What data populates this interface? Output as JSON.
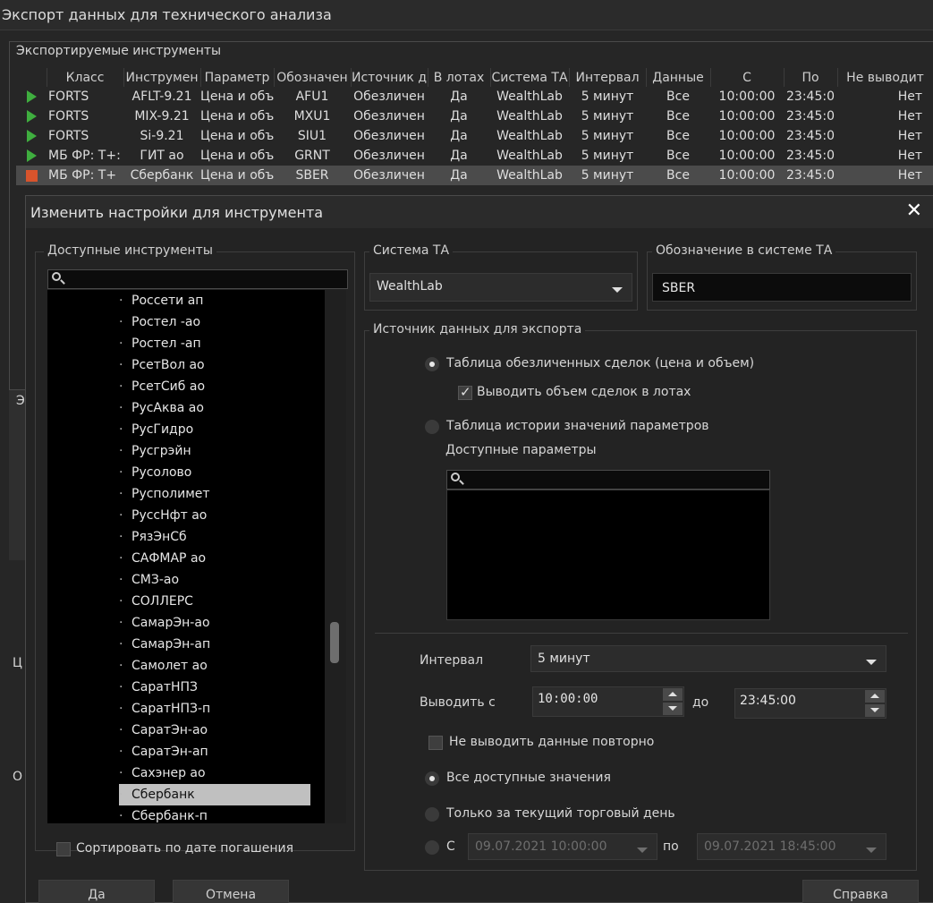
{
  "main_window": {
    "title": "Экспорт данных для технического анализа",
    "group_title": "Экспортируемые инструменты",
    "columns": [
      "",
      "Класс",
      "Инструмен",
      "Параметр",
      "Обозначен",
      "Источник д",
      "В лотах",
      "Система ТА",
      "Интервал",
      "Данные",
      "С",
      "По",
      "Не выводит"
    ],
    "rows": [
      {
        "status": "play",
        "class": "FORTS",
        "instrument": "AFLT-9.21",
        "param": "Цена и объ",
        "symbol": "AFU1",
        "source": "Обезличен",
        "lots": "Да",
        "ta": "WealthLab",
        "interval": "5 минут",
        "data": "Все",
        "from": "10:00:00",
        "to": "23:45:0",
        "no_repeat": "Нет"
      },
      {
        "status": "play",
        "class": "FORTS",
        "instrument": "MIX-9.21",
        "param": "Цена и объ",
        "symbol": "MXU1",
        "source": "Обезличен",
        "lots": "Да",
        "ta": "WealthLab",
        "interval": "5 минут",
        "data": "Все",
        "from": "10:00:00",
        "to": "23:45:0",
        "no_repeat": "Нет"
      },
      {
        "status": "play",
        "class": "FORTS",
        "instrument": "Si-9.21",
        "param": "Цена и объ",
        "symbol": "SIU1",
        "source": "Обезличен",
        "lots": "Да",
        "ta": "WealthLab",
        "interval": "5 минут",
        "data": "Все",
        "from": "10:00:00",
        "to": "23:45:0",
        "no_repeat": "Нет"
      },
      {
        "status": "play",
        "class": "МБ ФР: Т+:",
        "instrument": "ГИТ ао",
        "param": "Цена и объ",
        "symbol": "GRNT",
        "source": "Обезличен",
        "lots": "Да",
        "ta": "WealthLab",
        "interval": "5 минут",
        "data": "Все",
        "from": "10:00:00",
        "to": "23:45:0",
        "no_repeat": "Нет"
      },
      {
        "status": "stop",
        "class": "МБ ФР: Т+",
        "instrument": "Сбербанк",
        "param": "Цена и объ",
        "symbol": "SBER",
        "source": "Обезличен",
        "lots": "Да",
        "ta": "WealthLab",
        "interval": "5 минут",
        "data": "Все",
        "from": "10:00:00",
        "to": "23:45:0",
        "no_repeat": "Нет",
        "selected": true
      }
    ],
    "side_labels": [
      "Э",
      "Ц",
      "О"
    ]
  },
  "dialog": {
    "title": "Изменить настройки для инструмента",
    "close_label": "✕",
    "available_title": "Доступные инструменты",
    "instruments": [
      "Россети ап",
      "Ростел -ао",
      "Ростел -ап",
      "РсетВол ао",
      "РсетСиб ао",
      "РусАква ао",
      "РусГидро",
      "Русгрэйн",
      "Русолово",
      "Русполимет",
      "РуссНфт ао",
      "РязЭнСб",
      "САФМАР ао",
      "СМЗ-ао",
      "СОЛЛЕРС",
      "СамарЭн-ао",
      "СамарЭн-ап",
      "Самолет ао",
      "СаратНПЗ",
      "СаратНПЗ-п",
      "СаратЭн-ао",
      "СаратЭн-ап",
      "Сахэнер ао",
      "Сбербанк",
      "Сбербанк-п"
    ],
    "selected_instrument": "Сбербанк",
    "sort_by_maturity": "Сортировать по дате погашения",
    "ta_system_title": "Система ТА",
    "ta_system_value": "WealthLab",
    "ta_symbol_title": "Обозначение в системе ТА",
    "ta_symbol_value": "SBER",
    "source_title": "Источник данных для экспорта",
    "source_trades": "Таблица обезличенных сделок (цена и объем)",
    "volume_in_lots": "Выводить объем  сделок в лотах",
    "source_history": "Таблица истории значений параметров",
    "available_params": "Доступные параметры",
    "interval_label": "Интервал",
    "interval_value": "5 минут",
    "output_from_label": "Выводить с",
    "output_from_value": "10:00:00",
    "to_label": "до",
    "output_to_value": "23:45:00",
    "no_repeat": "Не выводить данные повторно",
    "all_values": "Все доступные значения",
    "today_only": "Только за текущий торговый день",
    "range_from_label": "С",
    "range_from_value": "09.07.2021 10:00:00",
    "range_to_label": "по",
    "range_to_value": "09.07.2021 18:45:00",
    "ok_label": "Да",
    "cancel_label": "Отмена",
    "help_label": "Справка"
  }
}
